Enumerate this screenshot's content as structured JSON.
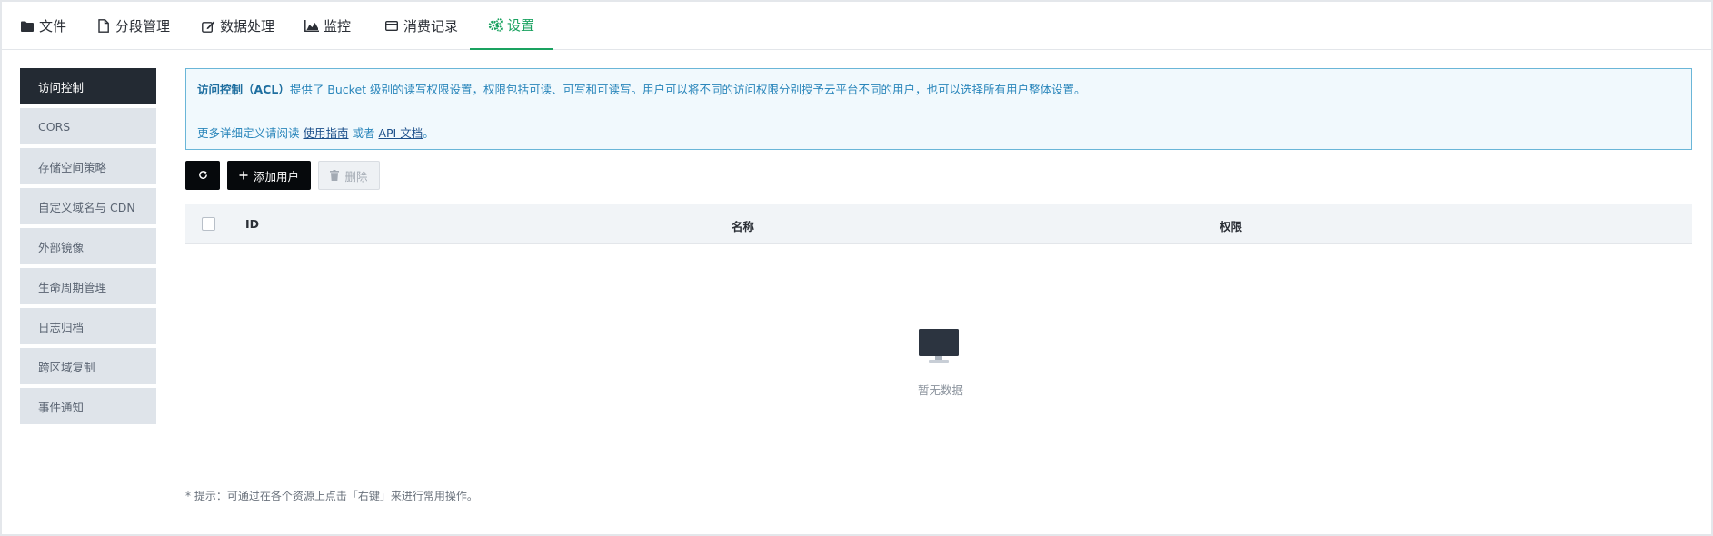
{
  "tabs": [
    {
      "label": "文件",
      "icon": "folder-icon"
    },
    {
      "label": "分段管理",
      "icon": "file-icon"
    },
    {
      "label": "数据处理",
      "icon": "edit-icon"
    },
    {
      "label": "监控",
      "icon": "area-chart-icon"
    },
    {
      "label": "消费记录",
      "icon": "credit-card-icon"
    },
    {
      "label": "设置",
      "icon": "cogs-icon",
      "active": true
    }
  ],
  "sidebar": {
    "items": [
      {
        "label": "访问控制",
        "active": true
      },
      {
        "label": "CORS"
      },
      {
        "label": "存储空间策略"
      },
      {
        "label": "自定义域名与 CDN"
      },
      {
        "label": "外部镜像"
      },
      {
        "label": "生命周期管理"
      },
      {
        "label": "日志归档"
      },
      {
        "label": "跨区域复制"
      },
      {
        "label": "事件通知"
      }
    ]
  },
  "notice": {
    "title": "访问控制（ACL）",
    "text1": "提供了 Bucket 级别的读写权限设置，权限包括可读、可写和可读写。用户可以将不同的访问权限分别授予云平台不同的用户，也可以选择所有用户整体设置。",
    "text2_prefix": "更多详细定义请阅读 ",
    "link_guide": "使用指南",
    "text2_mid": " 或者 ",
    "link_api": "API 文档",
    "text2_suffix": "。"
  },
  "toolbar": {
    "add_label": "添加用户",
    "delete_label": "删除"
  },
  "table": {
    "columns": [
      "ID",
      "名称",
      "权限"
    ],
    "empty_text": "暂无数据"
  },
  "hint": "* 提示：可通过在各个资源上点击「右键」来进行常用操作。",
  "colors": {
    "accent": "#1aa260",
    "sidebar_active": "#232a33",
    "notice_border": "#6ab6d8"
  }
}
